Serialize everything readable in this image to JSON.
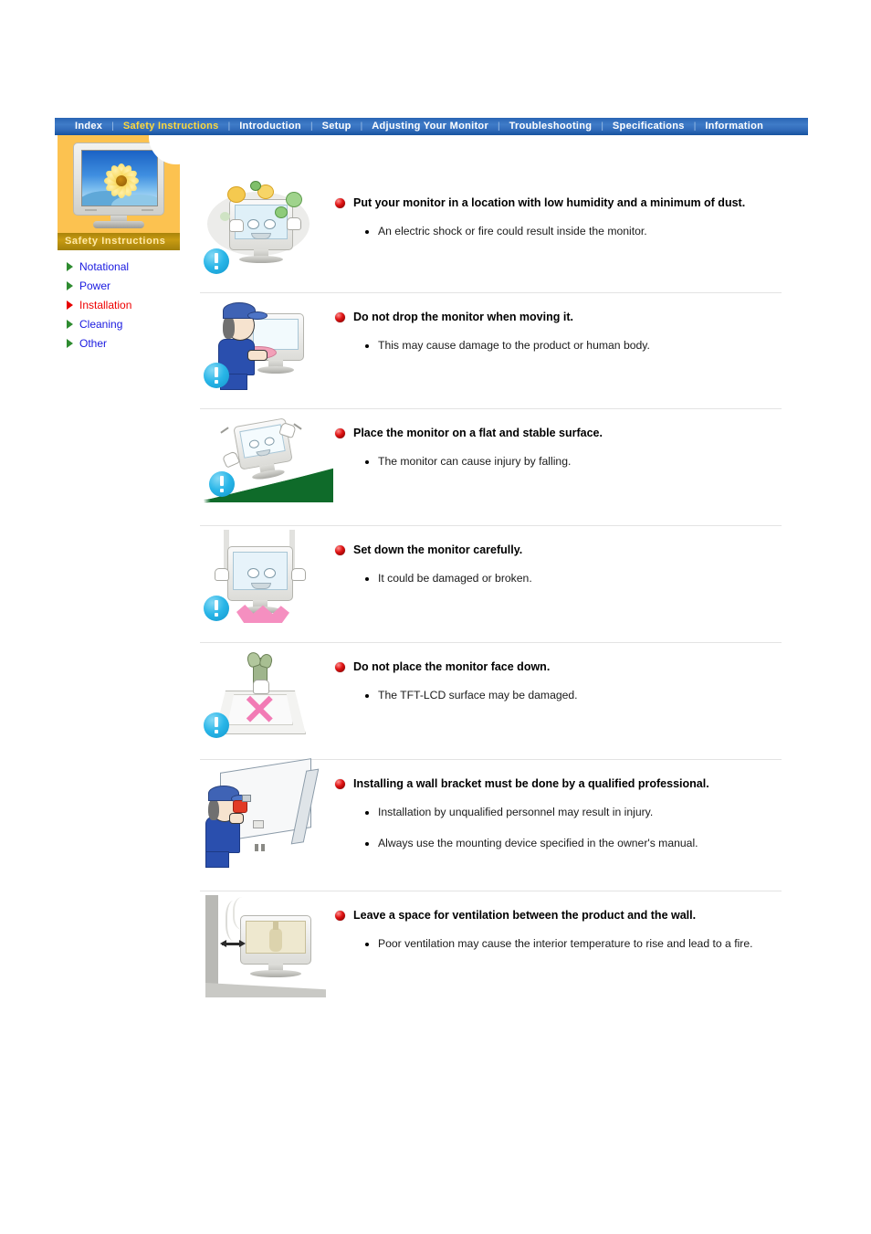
{
  "nav": {
    "items": [
      {
        "label": "Index",
        "active": false
      },
      {
        "label": "Safety Instructions",
        "active": true
      },
      {
        "label": "Introduction",
        "active": false
      },
      {
        "label": "Setup",
        "active": false
      },
      {
        "label": "Adjusting Your Monitor",
        "active": false
      },
      {
        "label": "Troubleshooting",
        "active": false
      },
      {
        "label": "Specifications",
        "active": false
      },
      {
        "label": "Information",
        "active": false
      }
    ],
    "separator": "|"
  },
  "sidebar": {
    "section_title": "Safety Instructions",
    "thumbnail_icon": "monitor-sunflower-thumbnail",
    "items": [
      {
        "label": "Notational",
        "active": false
      },
      {
        "label": "Power",
        "active": false
      },
      {
        "label": "Installation",
        "active": true
      },
      {
        "label": "Cleaning",
        "active": false
      },
      {
        "label": "Other",
        "active": false
      }
    ]
  },
  "colors": {
    "nav_background": "#2f69b8",
    "nav_active_text": "#ffd93b",
    "panel_orange": "#fcc250",
    "section_tab": "#c89b12",
    "link_blue": "#1a1ae0",
    "link_active_red": "#ee0000",
    "arrow_green": "#2e8b30",
    "arrow_active_red": "#e70000",
    "warning_bullet_red": "#e01414",
    "badge_blue": "#29b6e8"
  },
  "sections": [
    {
      "icon": "monitor-dust-humidity-illustration",
      "heading": "Put your monitor in a location with low humidity and a minimum of dust.",
      "bullets": [
        "An electric shock or fire could result inside the monitor."
      ]
    },
    {
      "icon": "worker-dropping-monitor-illustration",
      "heading": "Do not drop the monitor when moving it.",
      "bullets": [
        "This may cause damage to the product or human body."
      ]
    },
    {
      "icon": "monitor-on-slope-illustration",
      "heading": "Place the monitor on a flat and stable surface.",
      "bullets": [
        "The monitor can cause injury by falling."
      ]
    },
    {
      "icon": "monitor-set-down-impact-illustration",
      "heading": "Set down the monitor carefully.",
      "bullets": [
        "It could be damaged or broken."
      ]
    },
    {
      "icon": "monitor-face-down-prohibited-illustration",
      "heading": "Do not place the monitor face down.",
      "bullets": [
        "The TFT-LCD surface may be damaged."
      ]
    },
    {
      "icon": "wall-bracket-installation-illustration",
      "heading": "Installing a wall bracket must be done by a qualified professional.",
      "bullets": [
        "Installation by unqualified personnel may result in injury.",
        "Always use the mounting device specified in the owner's manual."
      ]
    },
    {
      "icon": "monitor-wall-ventilation-gap-illustration",
      "heading": "Leave a space for ventilation between the product and the wall.",
      "bullets": [
        "Poor ventilation may cause the interior temperature to rise and lead to a fire."
      ]
    }
  ]
}
